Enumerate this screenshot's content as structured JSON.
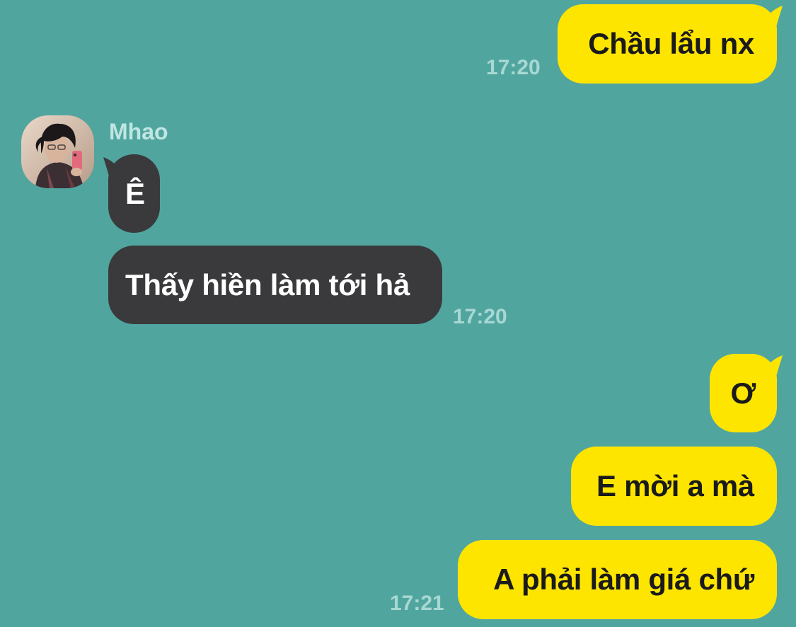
{
  "conversation": {
    "contact": {
      "name": "Mhao",
      "avatar_icon": "person-avatar"
    },
    "messages": [
      {
        "direction": "outgoing",
        "text": "Chầu lẩu nx",
        "time": "17:20"
      },
      {
        "direction": "incoming",
        "text": "Ê",
        "time": ""
      },
      {
        "direction": "incoming",
        "text": "Thấy hiền làm tới hả",
        "time": "17:20"
      },
      {
        "direction": "outgoing",
        "text": "Ơ",
        "time": ""
      },
      {
        "direction": "outgoing",
        "text": "E mời a mà",
        "time": ""
      },
      {
        "direction": "outgoing",
        "text": "A phải làm giá chứ",
        "time": "17:21"
      }
    ]
  },
  "colors": {
    "background": "#51a59f",
    "outgoing_bubble": "#fee500",
    "incoming_bubble": "#3a3a3c",
    "timestamp": "#a8d8d3"
  }
}
